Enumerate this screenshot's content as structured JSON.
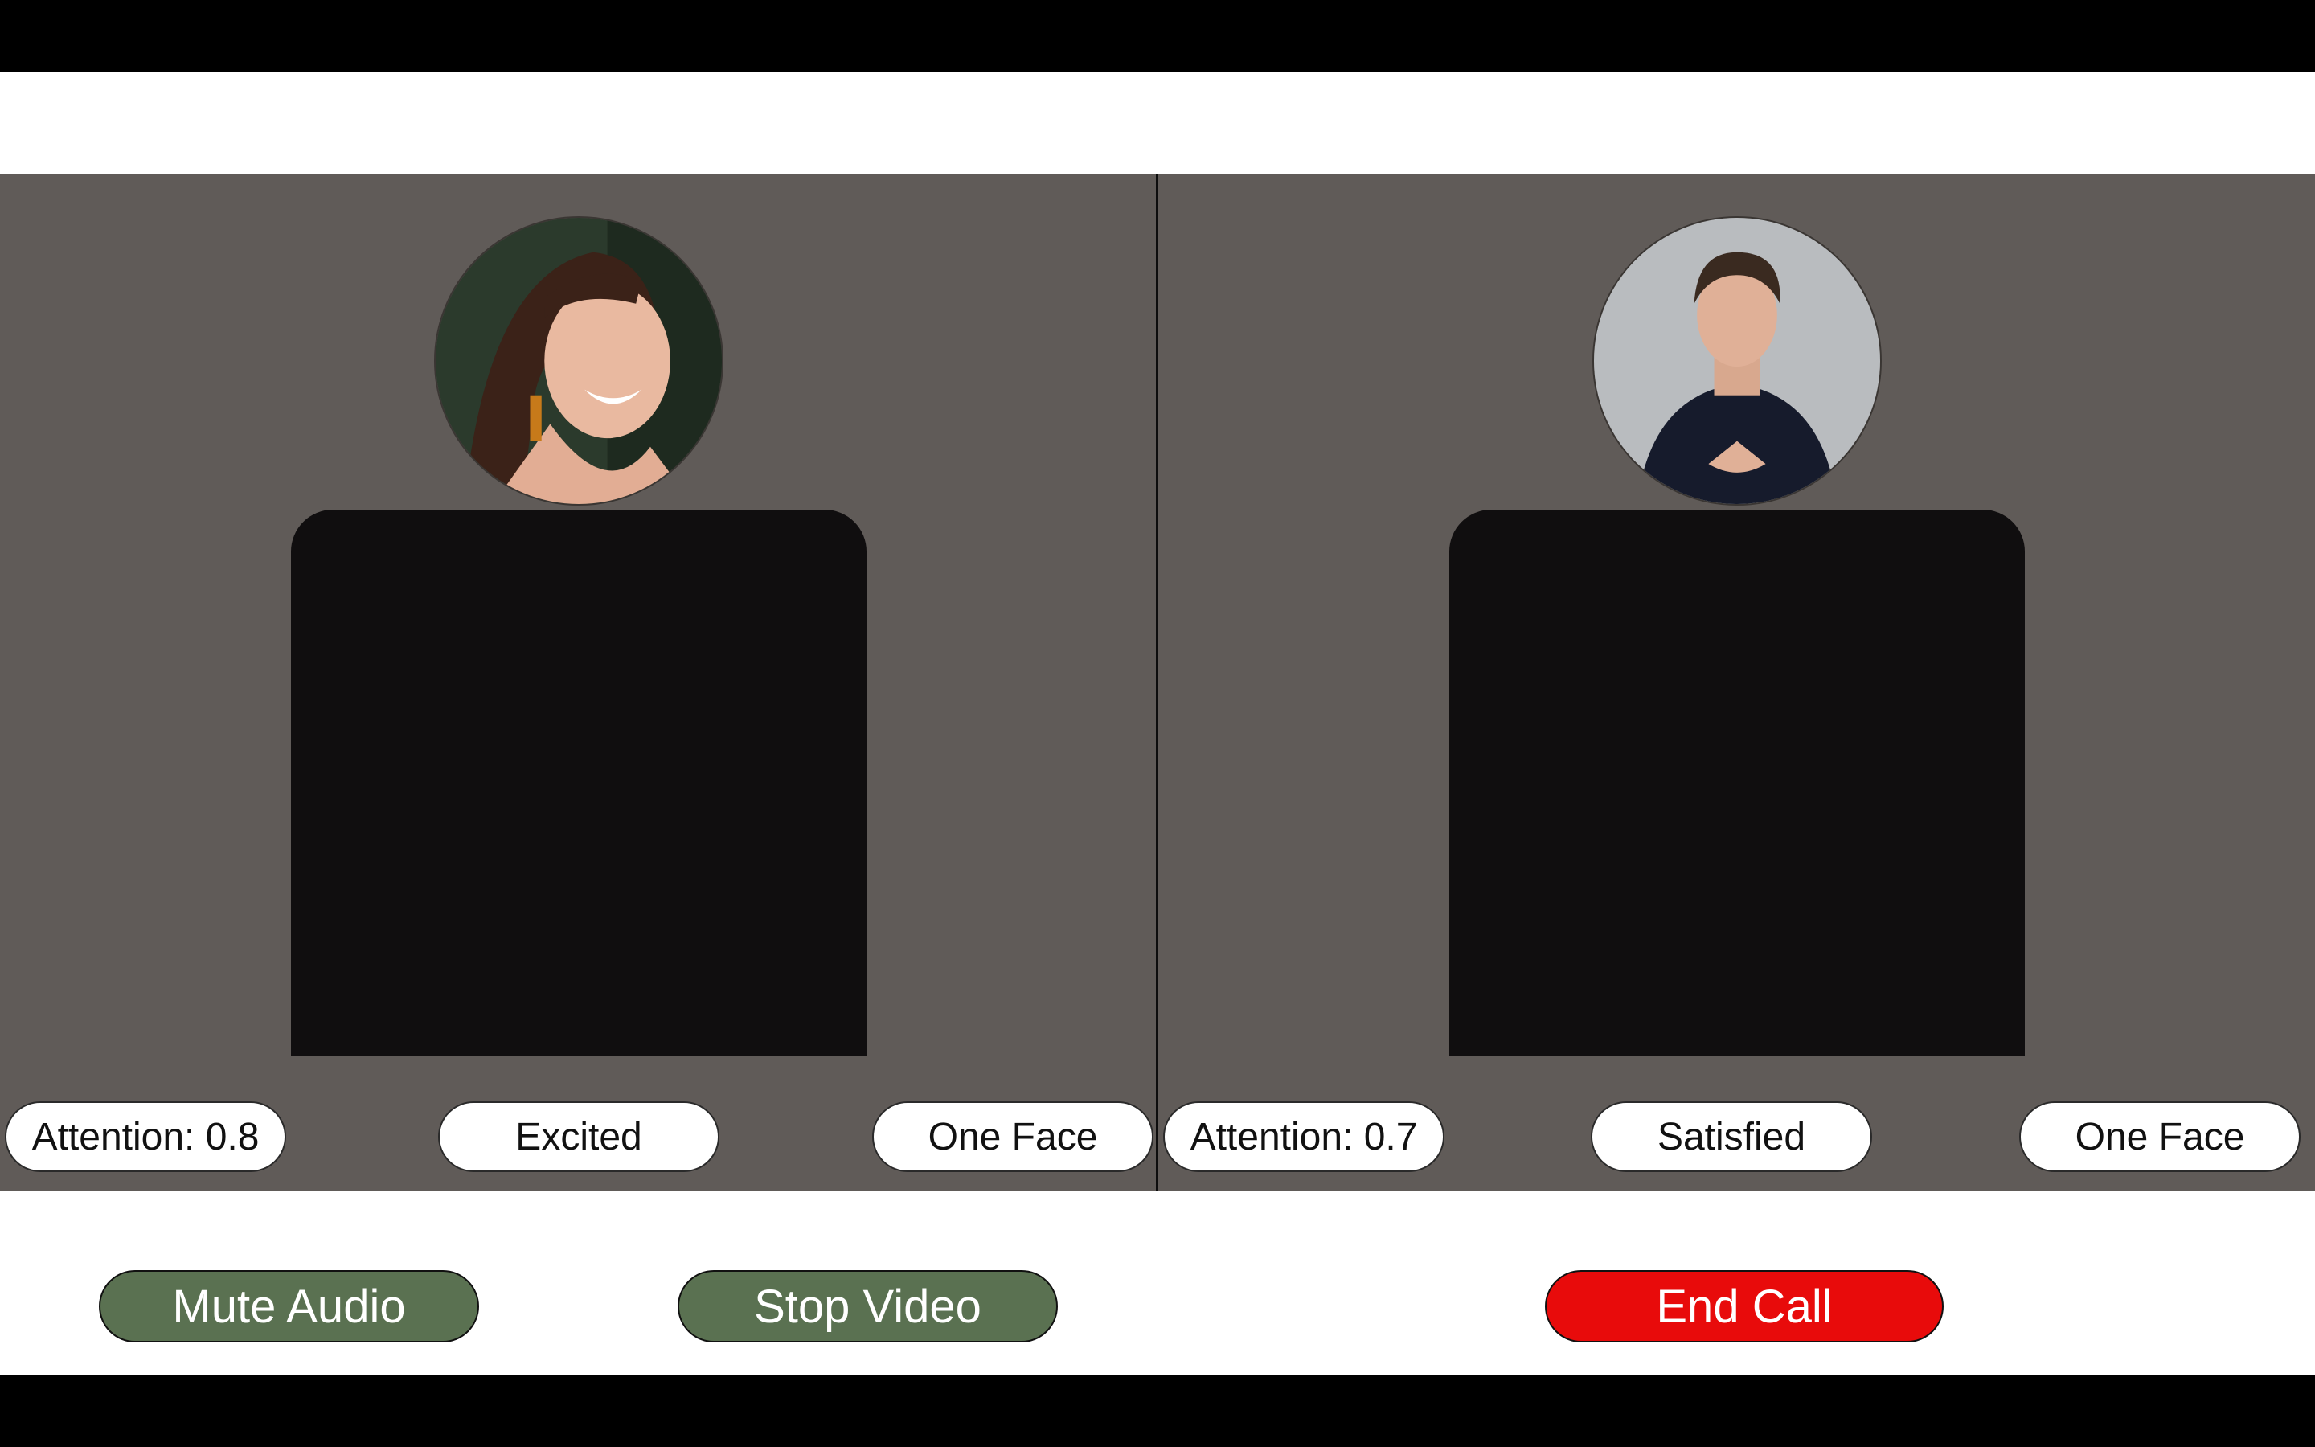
{
  "participants": [
    {
      "attention": "Attention: 0.8",
      "emotion": "Excited",
      "faces": "One Face"
    },
    {
      "attention": "Attention: 0.7",
      "emotion": "Satisfied",
      "faces": "One Face"
    }
  ],
  "controls": {
    "mute_label": "Mute Audio",
    "stop_video_label": "Stop Video",
    "end_call_label": "End Call"
  },
  "colors": {
    "stage_bg": "#605b58",
    "video_bg": "#100e0f",
    "control_green": "#5a7151",
    "end_call_red": "#e80b0b"
  }
}
